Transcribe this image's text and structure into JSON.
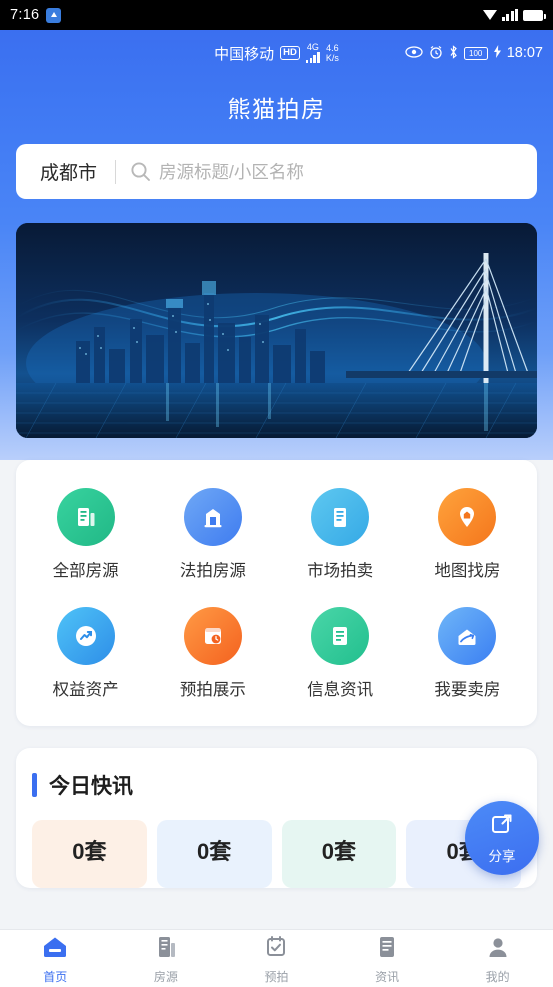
{
  "system_bar": {
    "time": "7:16",
    "badge_icon": "app-badge-icon",
    "icons": [
      "triangle-down-icon",
      "signal-bars-icon",
      "battery-icon"
    ]
  },
  "app_status": {
    "carrier": "中国移动",
    "hd_label": "HD",
    "network_type": "4G",
    "speed_value": "4.6",
    "speed_unit": "K/s",
    "icons": [
      "eye-icon",
      "alarm-icon",
      "bluetooth-icon",
      "battery-full-icon",
      "charging-icon"
    ],
    "battery_level": "100",
    "clock": "18:07"
  },
  "header": {
    "title": "熊猫拍房"
  },
  "search": {
    "city": "成都市",
    "placeholder": "房源标题/小区名称",
    "icon": "search-icon"
  },
  "banner": {
    "alt": "城市夜景与跨海大桥科技插图"
  },
  "grid": {
    "items": [
      {
        "label": "全部房源",
        "icon": "building-list-icon",
        "color_from": "#38d39f",
        "color_to": "#21b886"
      },
      {
        "label": "法拍房源",
        "icon": "courthouse-icon",
        "color_from": "#6fa8f5",
        "color_to": "#3f7cf0"
      },
      {
        "label": "市场拍卖",
        "icon": "market-building-icon",
        "color_from": "#5ec8f0",
        "color_to": "#35a9e6"
      },
      {
        "label": "地图找房",
        "icon": "map-pin-icon",
        "color_from": "#ffa33c",
        "color_to": "#f4761c"
      },
      {
        "label": "权益资产",
        "icon": "trend-arrow-icon",
        "color_from": "#4fc3f7",
        "color_to": "#2e8ee8"
      },
      {
        "label": "预拍展示",
        "icon": "calendar-clock-icon",
        "color_from": "#ff9a45",
        "color_to": "#f4621f"
      },
      {
        "label": "信息资讯",
        "icon": "document-icon",
        "color_from": "#4ad6a8",
        "color_to": "#22bf8e"
      },
      {
        "label": "我要卖房",
        "icon": "house-sell-icon",
        "color_from": "#6fb6f8",
        "color_to": "#3b7ff2"
      }
    ]
  },
  "news": {
    "title": "今日快讯",
    "stats": [
      {
        "value": "0",
        "unit": "套",
        "bg": "#fdf0e6"
      },
      {
        "value": "0",
        "unit": "套",
        "bg": "#e9f2fd"
      },
      {
        "value": "0",
        "unit": "套",
        "bg": "#e6f6f2"
      },
      {
        "value": "0",
        "unit": "套",
        "bg": "#e9f0fd"
      }
    ]
  },
  "fab": {
    "label": "分享",
    "icon": "share-external-icon"
  },
  "tabbar": {
    "items": [
      {
        "label": "首页",
        "icon": "home-icon",
        "active": true
      },
      {
        "label": "房源",
        "icon": "buildings-icon",
        "active": false
      },
      {
        "label": "预拍",
        "icon": "calendar-check-icon",
        "active": false
      },
      {
        "label": "资讯",
        "icon": "news-icon",
        "active": false
      },
      {
        "label": "我的",
        "icon": "user-icon",
        "active": false
      }
    ]
  }
}
